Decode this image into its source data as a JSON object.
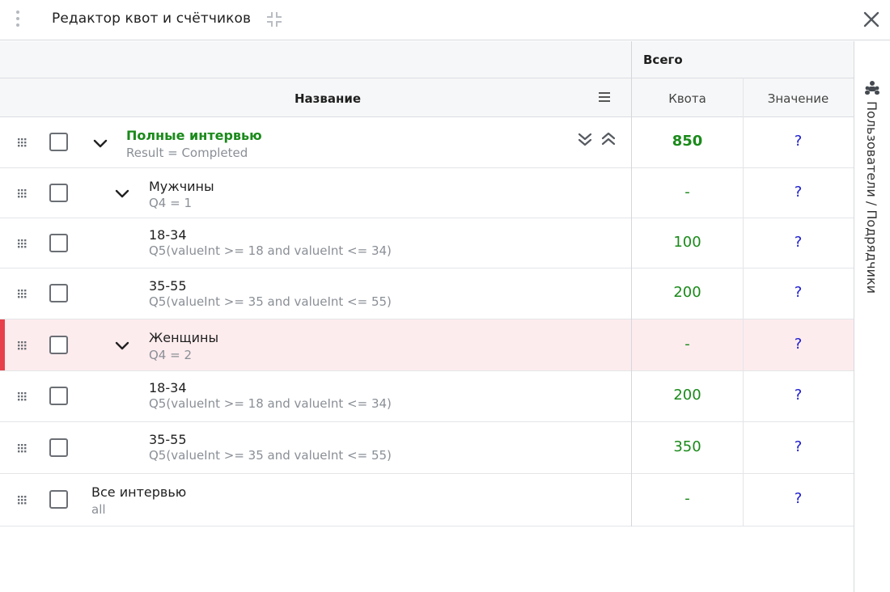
{
  "window": {
    "title": "Редактор квот и счётчиков"
  },
  "table": {
    "group_header": "Всего",
    "columns": {
      "name": "Название",
      "quota": "Квота",
      "value": "Значение"
    },
    "rows": [
      {
        "title": "Полные интервью",
        "condition": "Result = Completed",
        "quota": "850",
        "value": "?"
      },
      {
        "title": "Мужчины",
        "condition": "Q4 = 1",
        "quota": "-",
        "value": "?"
      },
      {
        "title": "18-34",
        "condition": "Q5(valueInt >= 18 and valueInt <= 34)",
        "quota": "100",
        "value": "?"
      },
      {
        "title": "35-55",
        "condition": "Q5(valueInt >= 35 and valueInt <= 55)",
        "quota": "200",
        "value": "?"
      },
      {
        "title": "Женщины",
        "condition": "Q4 = 2",
        "quota": "-",
        "value": "?"
      },
      {
        "title": "18-34",
        "condition": "Q5(valueInt >= 18 and valueInt <= 34)",
        "quota": "200",
        "value": "?"
      },
      {
        "title": "35-55",
        "condition": "Q5(valueInt >= 35 and valueInt <= 55)",
        "quota": "350",
        "value": "?"
      },
      {
        "title": "Все интервью",
        "condition": "all",
        "quota": "-",
        "value": "?"
      }
    ]
  },
  "side_panel": {
    "label": "Пользователи / Подрядчики",
    "icon": "users-icon"
  },
  "colors": {
    "quota_green": "#1a8a1a",
    "value_blue": "#1a1ad0",
    "selected_row_bg": "#fdecee",
    "selected_marker": "#e8404a"
  },
  "icons": {
    "drag": "drag-handle-icon",
    "close": "close-icon",
    "collapse": "collapse-icon",
    "menu": "menu-icon",
    "chevron": "chevron-down-icon",
    "expand_all": "expand-all-icon",
    "collapse_all": "collapse-all-icon"
  }
}
